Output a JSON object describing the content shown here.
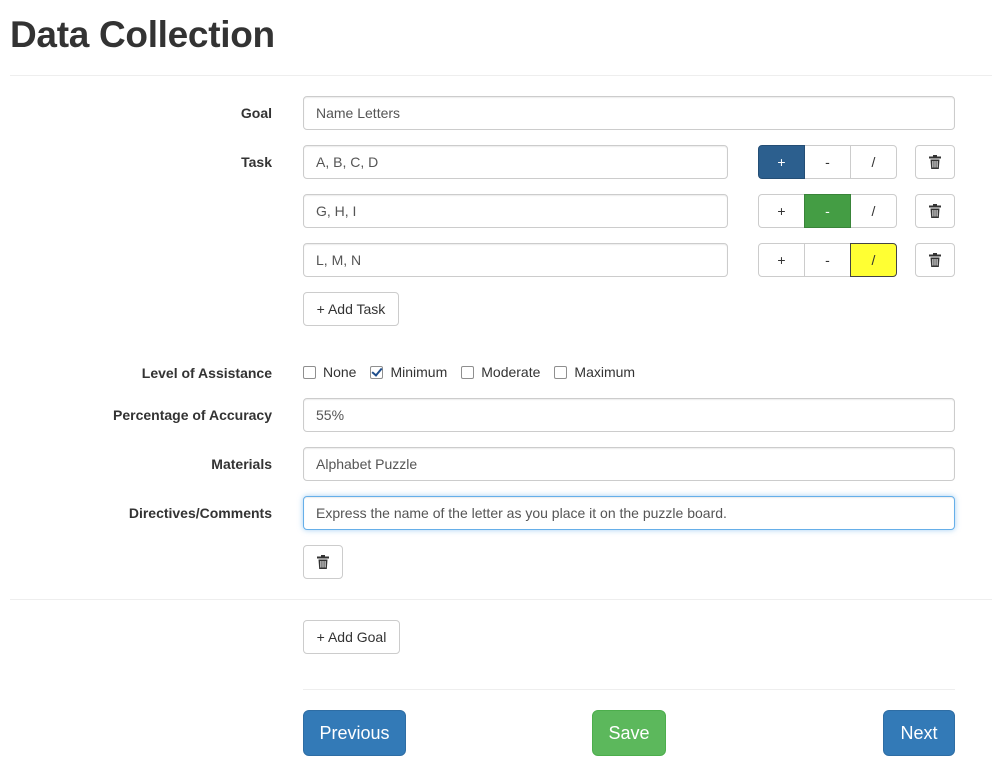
{
  "page": {
    "title": "Data Collection"
  },
  "form": {
    "goal": {
      "label": "Goal",
      "value": "Name Letters"
    },
    "task": {
      "label": "Task",
      "items": [
        {
          "value": "A, B, C, D",
          "selected": "+"
        },
        {
          "value": "G, H, I",
          "selected": "-"
        },
        {
          "value": "L, M, N",
          "selected": "/"
        }
      ],
      "score_options": [
        "+",
        "-",
        "/"
      ],
      "add_label": "+ Add Task"
    },
    "assistance": {
      "label": "Level of Assistance",
      "options": [
        {
          "label": "None",
          "checked": false
        },
        {
          "label": "Minimum",
          "checked": true
        },
        {
          "label": "Moderate",
          "checked": false
        },
        {
          "label": "Maximum",
          "checked": false
        }
      ]
    },
    "accuracy": {
      "label": "Percentage of Accuracy",
      "value": "55%"
    },
    "materials": {
      "label": "Materials",
      "value": "Alphabet Puzzle"
    },
    "comments": {
      "label": "Directives/Comments",
      "value": "Express the name of the letter as you place it on the puzzle board."
    }
  },
  "actions": {
    "add_goal": "+ Add Goal",
    "previous": "Previous",
    "save": "Save",
    "next": "Next"
  },
  "colors": {
    "plus_active": "#2c5f8e",
    "minus_active": "#449d44",
    "slash_active": "#ffff33",
    "primary": "#337ab7",
    "success": "#5cb85c"
  },
  "icons": {
    "delete": "trash-icon",
    "checkbox_checked": "checkmark-icon"
  }
}
